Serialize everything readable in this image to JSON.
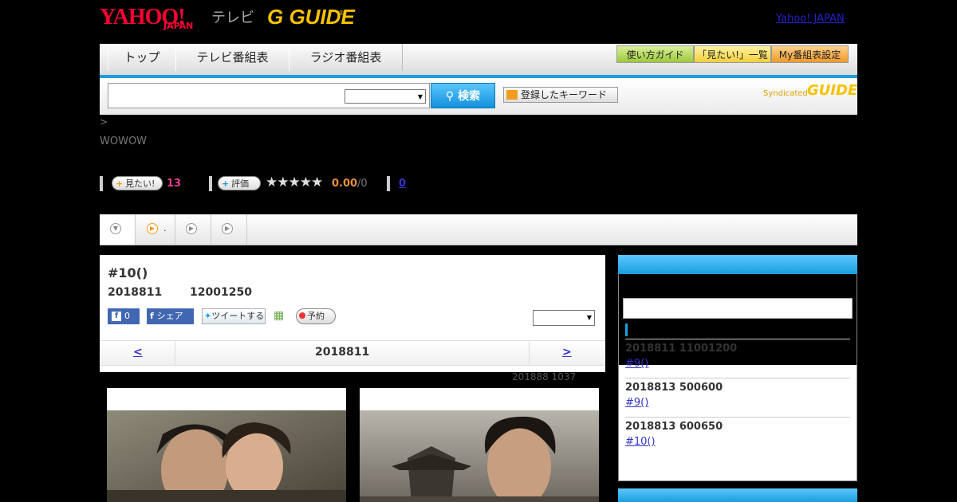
{
  "header": {
    "logo_yahoo": "YAHOO!",
    "logo_japan": "JAPAN",
    "logo_tv": "テレビ",
    "logo_gguide": "G GUIDE",
    "logo_reg": "®",
    "yahoo_link": "Yahoo! JAPAN"
  },
  "nav": {
    "tabs": [
      {
        "label": "トップ"
      },
      {
        "label": "テレビ番組表"
      },
      {
        "label": "ラジオ番組表"
      }
    ],
    "right_buttons": [
      {
        "label": "使い方ガイド"
      },
      {
        "label": "「見たい!」一覧"
      },
      {
        "label": "My番組表設定"
      }
    ]
  },
  "search": {
    "button_label": "検索",
    "keyword_button": "登録したキーワード",
    "syndicated": "Syndicated",
    "syndicated_logo": "GUIDE"
  },
  "breadcrumb": ">",
  "channel": "WOWOW",
  "stats": {
    "want_label": "見たい!",
    "want_count": "13",
    "rating_label": "評価",
    "stars": "★★★★★",
    "rating_score": "0.00",
    "rating_count": "/0",
    "comment_count": "0"
  },
  "subtabs": [
    {
      "label": ""
    },
    {
      "label": "."
    },
    {
      "label": ""
    },
    {
      "label": ""
    }
  ],
  "program": {
    "episode_title": "#10()",
    "air_date": "2018811",
    "air_time": "12001250",
    "fb_like_count": "0",
    "fb_share": "シェア",
    "tweet": "ツイートする",
    "reserve": "予約",
    "prev": "<",
    "current_date": "2018811",
    "next": ">",
    "update_note": "201888  1037"
  },
  "sidebar": {
    "items": [
      {
        "date": "2018811  11001200",
        "link": "#9()       "
      },
      {
        "date": "2018813  500600",
        "link": "#9()       "
      },
      {
        "date": "2018813  600650",
        "link": "#10()       "
      }
    ]
  },
  "icons": {
    "search": "search-icon",
    "dropdown": "chevron-down-icon",
    "calendar": "calendar-add-icon",
    "play": "play-icon"
  },
  "colors": {
    "accent_blue": "#1a9ede",
    "yahoo_red": "#ff0033",
    "gguide_yellow": "#f6c200",
    "want_pink": "#e63e8f",
    "rating_orange": "#e89036"
  }
}
